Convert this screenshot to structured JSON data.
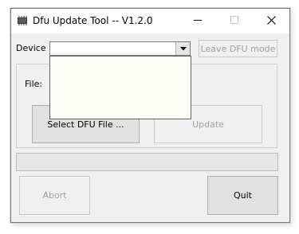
{
  "window": {
    "title": "Dfu Update Tool -- V1.2.0",
    "icons": [
      "app-chip-icon",
      "minimize-icon",
      "maximize-icon",
      "close-icon"
    ]
  },
  "device": {
    "label": "Device",
    "selected": "",
    "leave_dfu_label": "Leave DFU mode"
  },
  "file": {
    "label": "File:",
    "select_label": "Select DFU File ...",
    "update_label": "Update"
  },
  "progress": {
    "value": 0
  },
  "actions": {
    "abort_label": "Abort",
    "quit_label": "Quit"
  },
  "colors": {
    "window_bg": "#f0f0f0",
    "disabled_text": "#a0a0a0",
    "dropdown_bg": "#fffff9"
  }
}
